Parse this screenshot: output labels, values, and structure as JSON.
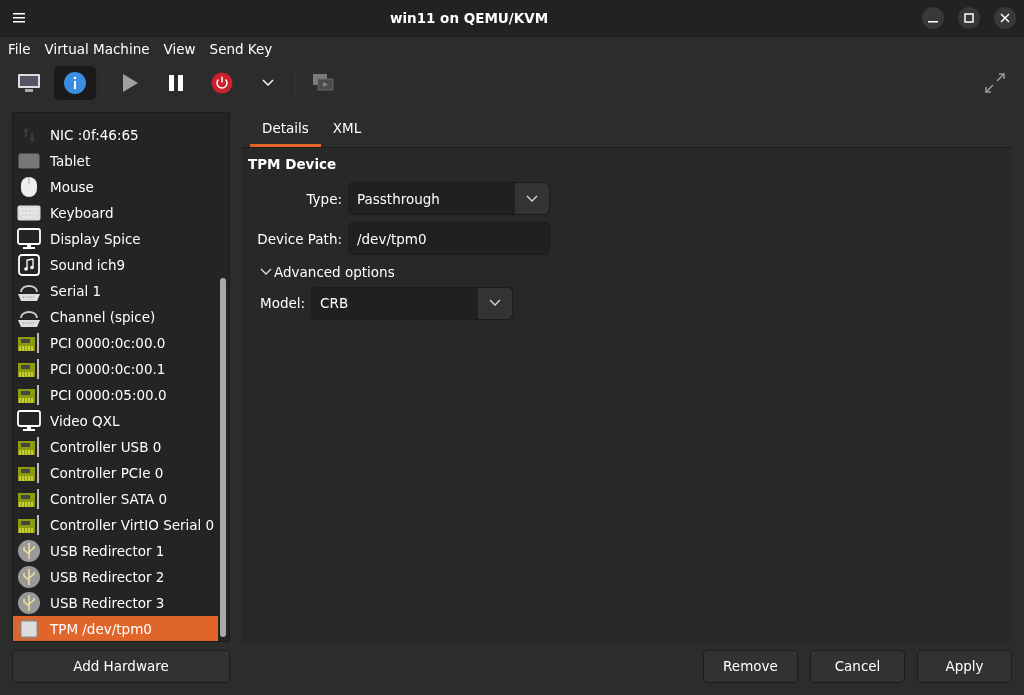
{
  "window": {
    "title": "win11 on QEMU/KVM"
  },
  "menu": [
    "File",
    "Virtual Machine",
    "View",
    "Send Key"
  ],
  "toolbar": [
    {
      "kind": "console",
      "selected": false,
      "disabled": false
    },
    {
      "kind": "info",
      "selected": true,
      "disabled": false
    },
    {
      "kind": "run",
      "selected": false,
      "disabled": true
    },
    {
      "kind": "pause",
      "selected": false,
      "disabled": false
    },
    {
      "kind": "power",
      "selected": false,
      "disabled": false
    },
    {
      "kind": "caret",
      "selected": false,
      "disabled": false
    },
    {
      "kind": "snapshots",
      "selected": false,
      "disabled": true
    }
  ],
  "sidebar": {
    "items": [
      {
        "kind": "nic",
        "label": "NIC :0f:46:65",
        "selected": false
      },
      {
        "kind": "tablet",
        "label": "Tablet",
        "selected": false
      },
      {
        "kind": "mouse",
        "label": "Mouse",
        "selected": false
      },
      {
        "kind": "keyboard",
        "label": "Keyboard",
        "selected": false
      },
      {
        "kind": "display",
        "label": "Display Spice",
        "selected": false
      },
      {
        "kind": "sound",
        "label": "Sound ich9",
        "selected": false
      },
      {
        "kind": "serial",
        "label": "Serial 1",
        "selected": false
      },
      {
        "kind": "serial",
        "label": "Channel (spice)",
        "selected": false
      },
      {
        "kind": "pci",
        "label": "PCI 0000:0c:00.0",
        "selected": false
      },
      {
        "kind": "pci",
        "label": "PCI 0000:0c:00.1",
        "selected": false
      },
      {
        "kind": "pci",
        "label": "PCI 0000:05:00.0",
        "selected": false
      },
      {
        "kind": "display",
        "label": "Video QXL",
        "selected": false
      },
      {
        "kind": "pci",
        "label": "Controller USB 0",
        "selected": false
      },
      {
        "kind": "pci",
        "label": "Controller PCIe 0",
        "selected": false
      },
      {
        "kind": "pci",
        "label": "Controller SATA 0",
        "selected": false
      },
      {
        "kind": "pci",
        "label": "Controller VirtIO Serial 0",
        "selected": false
      },
      {
        "kind": "usb",
        "label": "USB Redirector 1",
        "selected": false
      },
      {
        "kind": "usb",
        "label": "USB Redirector 2",
        "selected": false
      },
      {
        "kind": "usb",
        "label": "USB Redirector 3",
        "selected": false
      },
      {
        "kind": "chip",
        "label": "TPM /dev/tpm0",
        "selected": true
      }
    ],
    "add_button": "Add Hardware"
  },
  "tabs": [
    {
      "label": "Details",
      "selected": true
    },
    {
      "label": "XML",
      "selected": false
    }
  ],
  "details": {
    "section": "TPM Device",
    "fields": [
      {
        "kind": "combo",
        "label": "Type:",
        "value": "Passthrough"
      },
      {
        "kind": "entry",
        "label": "Device Path:",
        "value": "/dev/tpm0"
      }
    ],
    "expander": {
      "label": "Advanced options",
      "expanded": true,
      "fields": [
        {
          "kind": "combo",
          "label": "Model:",
          "value": "CRB"
        }
      ]
    }
  },
  "buttons": [
    "Remove",
    "Cancel",
    "Apply"
  ]
}
